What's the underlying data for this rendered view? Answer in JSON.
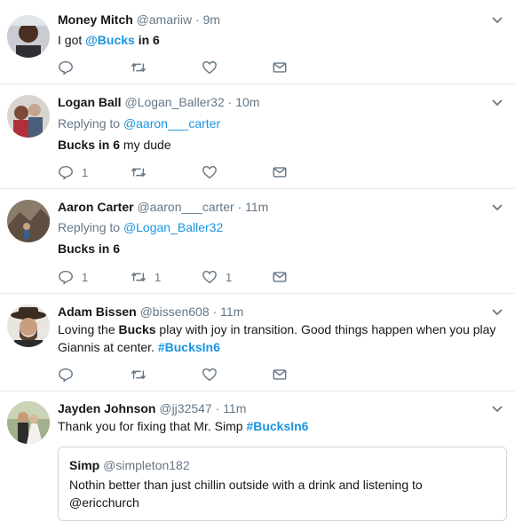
{
  "tweets": [
    {
      "name": "Money Mitch",
      "handle": "@amariiw",
      "sep": "·",
      "time": "9m",
      "text_parts": [
        "I got ",
        "@Bucks",
        " in 6"
      ],
      "counts": {
        "reply": "",
        "retweet": "",
        "like": ""
      }
    },
    {
      "name": "Logan Ball",
      "handle": "@Logan_Baller32",
      "sep": "·",
      "time": "10m",
      "replying_prefix": "Replying to ",
      "replying_to": "@aaron___carter",
      "text_parts": [
        "Bucks in 6",
        " my dude"
      ],
      "counts": {
        "reply": "1",
        "retweet": "",
        "like": ""
      }
    },
    {
      "name": "Aaron Carter",
      "handle": "@aaron___carter",
      "sep": "·",
      "time": "11m",
      "replying_prefix": "Replying to ",
      "replying_to": "@Logan_Baller32",
      "text_parts": [
        "Bucks in 6"
      ],
      "counts": {
        "reply": "1",
        "retweet": "1",
        "like": "1"
      }
    },
    {
      "name": "Adam Bissen",
      "handle": "@bissen608",
      "sep": "·",
      "time": "11m",
      "text_parts": [
        "Loving the ",
        "Bucks",
        " play with joy in transition. Good things happen when you play",
        "Giannis at center. ",
        "#BucksIn6"
      ],
      "counts": {
        "reply": "",
        "retweet": "",
        "like": ""
      }
    },
    {
      "name": "Jayden Johnson",
      "handle": "@jj32547",
      "sep": "·",
      "time": "11m",
      "text_parts": [
        "Thank you for fixing that Mr. Simp ",
        "#BucksIn6"
      ],
      "quote": {
        "name": "Simp",
        "handle": "@simpleton182",
        "text_line1": "Nothin better than just chillin outside with a drink and listening to",
        "text_line2": "@ericchurch"
      }
    }
  ],
  "icons": {
    "reply": "reply-icon",
    "retweet": "retweet-icon",
    "like": "heart-icon",
    "dm": "envelope-icon",
    "caret": "chevron-down-icon"
  },
  "colors": {
    "link": "#1b95e0",
    "muted": "#657786",
    "text": "#14171a",
    "divider": "#e6ecf0"
  }
}
